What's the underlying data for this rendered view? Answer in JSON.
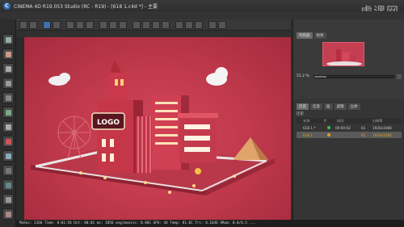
{
  "window": {
    "title": "CINEMA 4D R19.053 Studio (RC - R19) - [618 1.c4d *] - 主要",
    "watermark": "虎课网"
  },
  "status_bar": {
    "text": "MuSec: 2166  Time: 0:01:56  Oct: 00:01  ms: 1056  avg/moovis: 0.001  GPU: 44  Temp: 81.6C  Tri: 0.1036  VRam: 0.0/6.5  ..."
  },
  "picture_viewer": {
    "tabs": [
      "导航器",
      "柱状"
    ],
    "zoom": "51.2 %",
    "zoom_fraction": 0.15,
    "section_tabs": [
      "历史",
      "信息",
      "层",
      "滤镜",
      "立体"
    ],
    "section_label": "历史",
    "columns": [
      "名称",
      "R",
      "时间",
      "分辨率"
    ],
    "rows": [
      {
        "name": "618 1.*",
        "r": "",
        "time": "00:00:02",
        "frame": "61",
        "resolution": "1920x1080",
        "status_color": "#35c24a",
        "selected": false
      },
      {
        "name": "618 1",
        "r": "",
        "time": "",
        "frame": "61",
        "resolution": "1920x1080",
        "status_color": "#e0a020",
        "selected": true
      }
    ]
  },
  "scene": {
    "logo_text": "LOGO"
  }
}
